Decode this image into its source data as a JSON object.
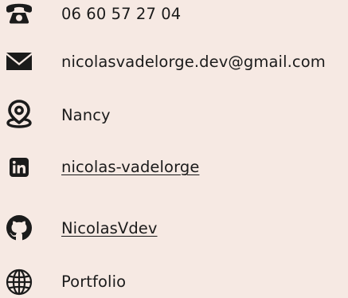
{
  "contacts": [
    {
      "icon": "phone-icon",
      "label": "06 60 57 27 04"
    },
    {
      "icon": "envelope-icon",
      "label": "nicolasvadelorge.dev@gmail.com"
    },
    {
      "icon": "map-pin-icon",
      "label": "Nancy"
    },
    {
      "icon": "linkedin-icon",
      "label": "nicolas-vadelorge"
    },
    {
      "icon": "github-icon",
      "label": "NicolasVdev"
    },
    {
      "icon": "globe-icon",
      "label": "Portfolio"
    }
  ],
  "colors": {
    "background": "#f6e9e3",
    "text": "#1b1b1b",
    "icon": "#1b1b1b"
  }
}
